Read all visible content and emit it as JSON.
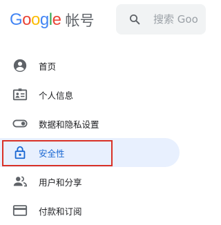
{
  "header": {
    "logo_letters": [
      {
        "char": "G",
        "color": "#4285F4"
      },
      {
        "char": "o",
        "color": "#EA4335"
      },
      {
        "char": "o",
        "color": "#FBBC05"
      },
      {
        "char": "g",
        "color": "#4285F4"
      },
      {
        "char": "l",
        "color": "#34A853"
      },
      {
        "char": "e",
        "color": "#EA4335"
      }
    ],
    "product_name": "帐号",
    "search": {
      "placeholder": "搜索 Goo",
      "icon": "search-icon"
    }
  },
  "nav": {
    "items": [
      {
        "label": "首页",
        "icon": "account-circle-icon",
        "active": false
      },
      {
        "label": "个人信息",
        "icon": "id-card-icon",
        "active": false
      },
      {
        "label": "数据和隐私设置",
        "icon": "toggle-icon",
        "active": false
      },
      {
        "label": "安全性",
        "icon": "lock-icon",
        "active": true
      },
      {
        "label": "用户和分享",
        "icon": "people-icon",
        "active": false
      },
      {
        "label": "付款和订阅",
        "icon": "credit-card-icon",
        "active": false
      }
    ]
  },
  "colors": {
    "active_background": "#e8f0fe",
    "active_text": "#1967d2",
    "icon_gray": "#5f6368",
    "highlight_border": "#d93025",
    "search_background": "#f1f3f4"
  }
}
